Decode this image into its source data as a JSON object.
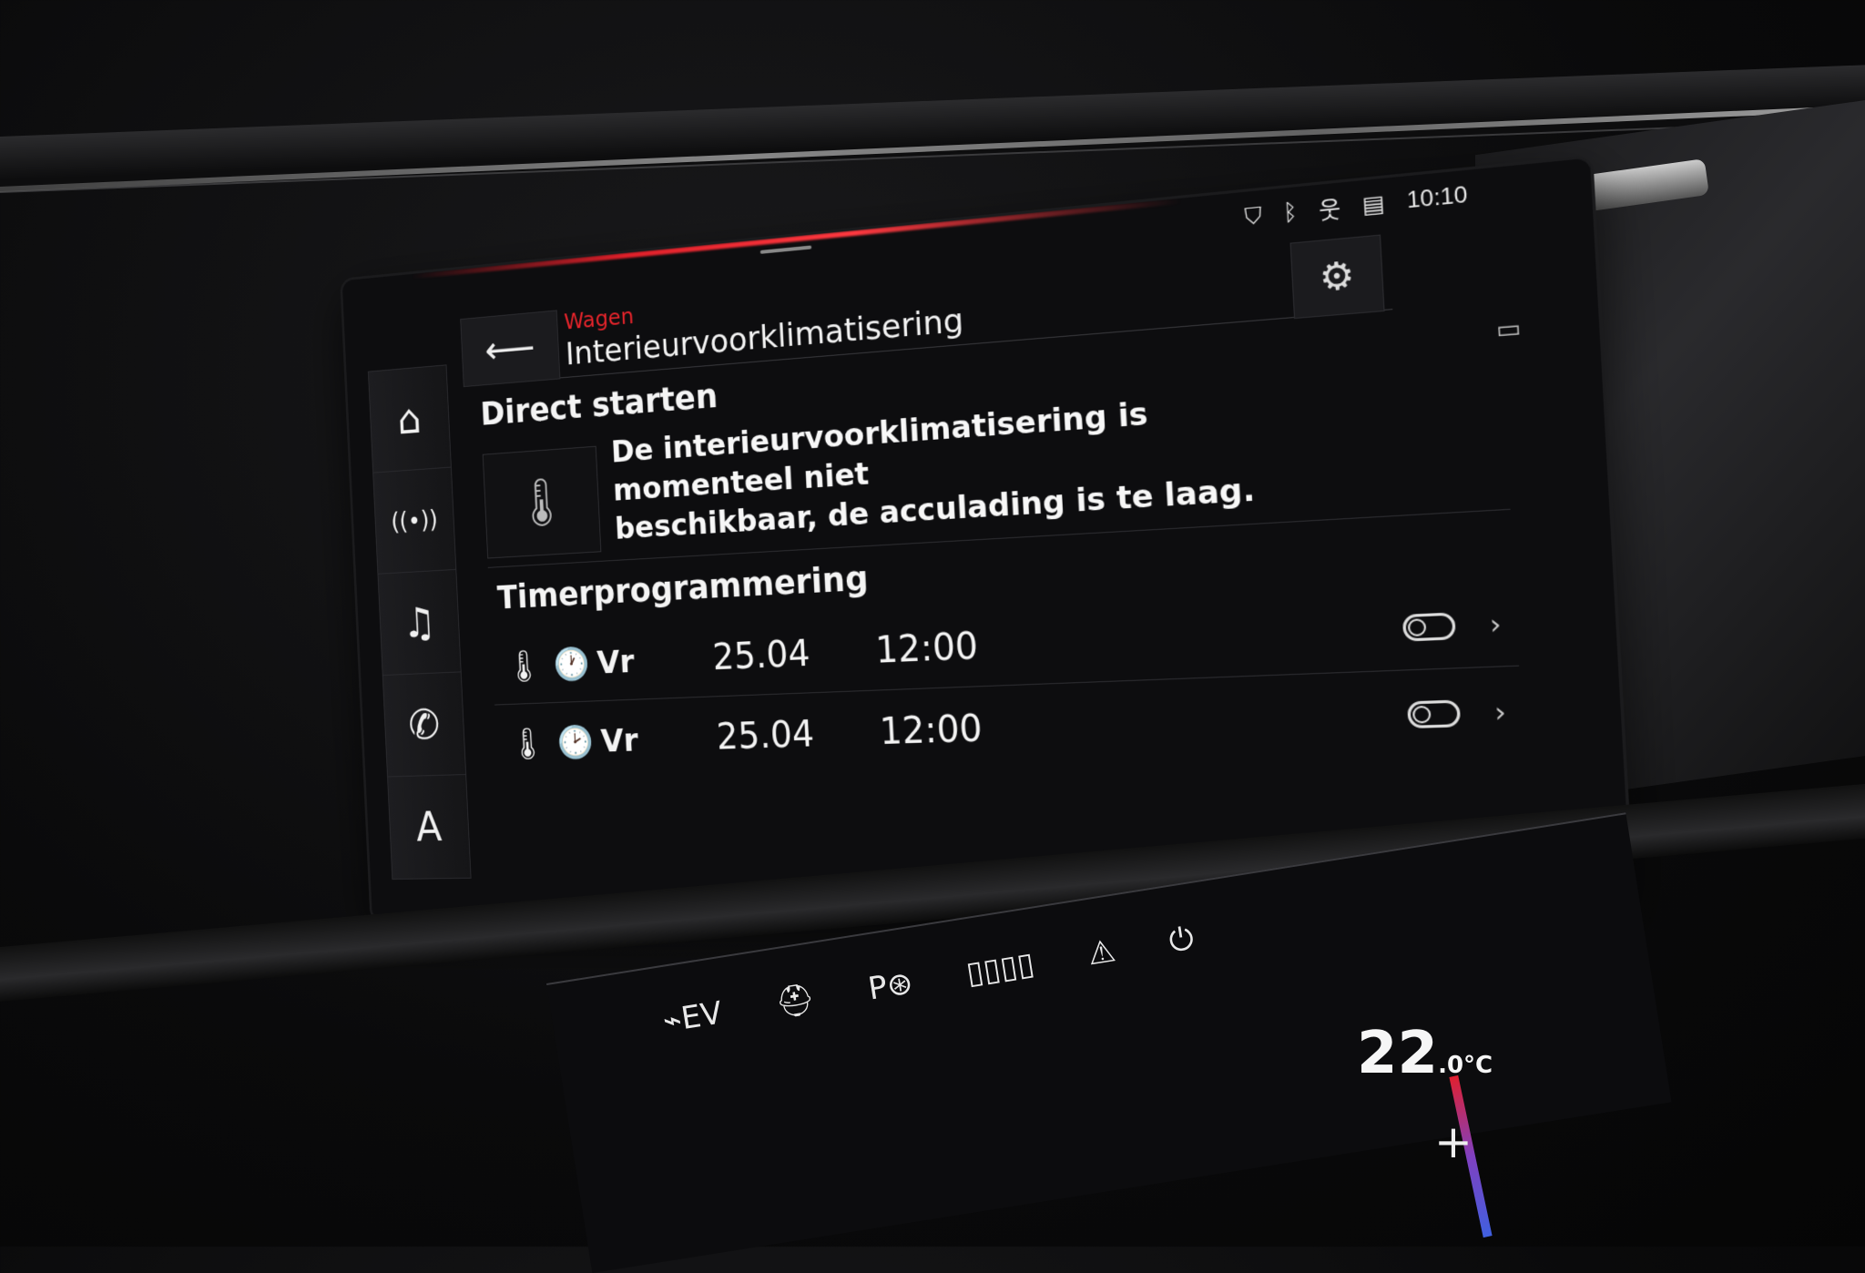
{
  "status_bar": {
    "icons": [
      "location-shield-icon",
      "bluetooth-icon",
      "passenger-icon",
      "signal-icon"
    ],
    "icon_glyphs": [
      "⛉",
      "ᛒ",
      "웃",
      "▤"
    ],
    "time": "10:10"
  },
  "nav": {
    "items": [
      {
        "name": "home",
        "glyph": "⌂"
      },
      {
        "name": "radio",
        "glyph": "((•))"
      },
      {
        "name": "media",
        "glyph": "♫"
      },
      {
        "name": "phone",
        "glyph": "✆"
      },
      {
        "name": "navigation",
        "glyph": "A"
      }
    ]
  },
  "header": {
    "back_glyph": "⟵",
    "breadcrumb": "Wagen",
    "title": "Interieurvoorklimatisering",
    "settings_glyph": "⚙"
  },
  "direct_start": {
    "title": "Direct starten",
    "thermo_glyph": "🌡",
    "message_line1": "De interieurvoorklimatisering is momenteel niet",
    "message_line2": "beschikbaar, de acculading is te laag.",
    "battery_glyph": "▭"
  },
  "timers": {
    "title": "Timerprogrammering",
    "rows": [
      {
        "thermo": "🌡",
        "clock": "🕐",
        "day": "Vr",
        "date": "25.04",
        "time": "12:00",
        "chevron": "›"
      },
      {
        "thermo": "🌡",
        "clock": "🕑",
        "day": "Vr",
        "date": "25.04",
        "time": "12:00",
        "chevron": "›"
      }
    ]
  },
  "climate": {
    "icons": [
      "⌁EV",
      "⛑",
      "P⊛",
      "▯▯▯▯",
      "⚠",
      "⏻"
    ],
    "temperature": "22",
    "temperature_decimal": ".0",
    "unit": "°C",
    "plus": "+"
  }
}
